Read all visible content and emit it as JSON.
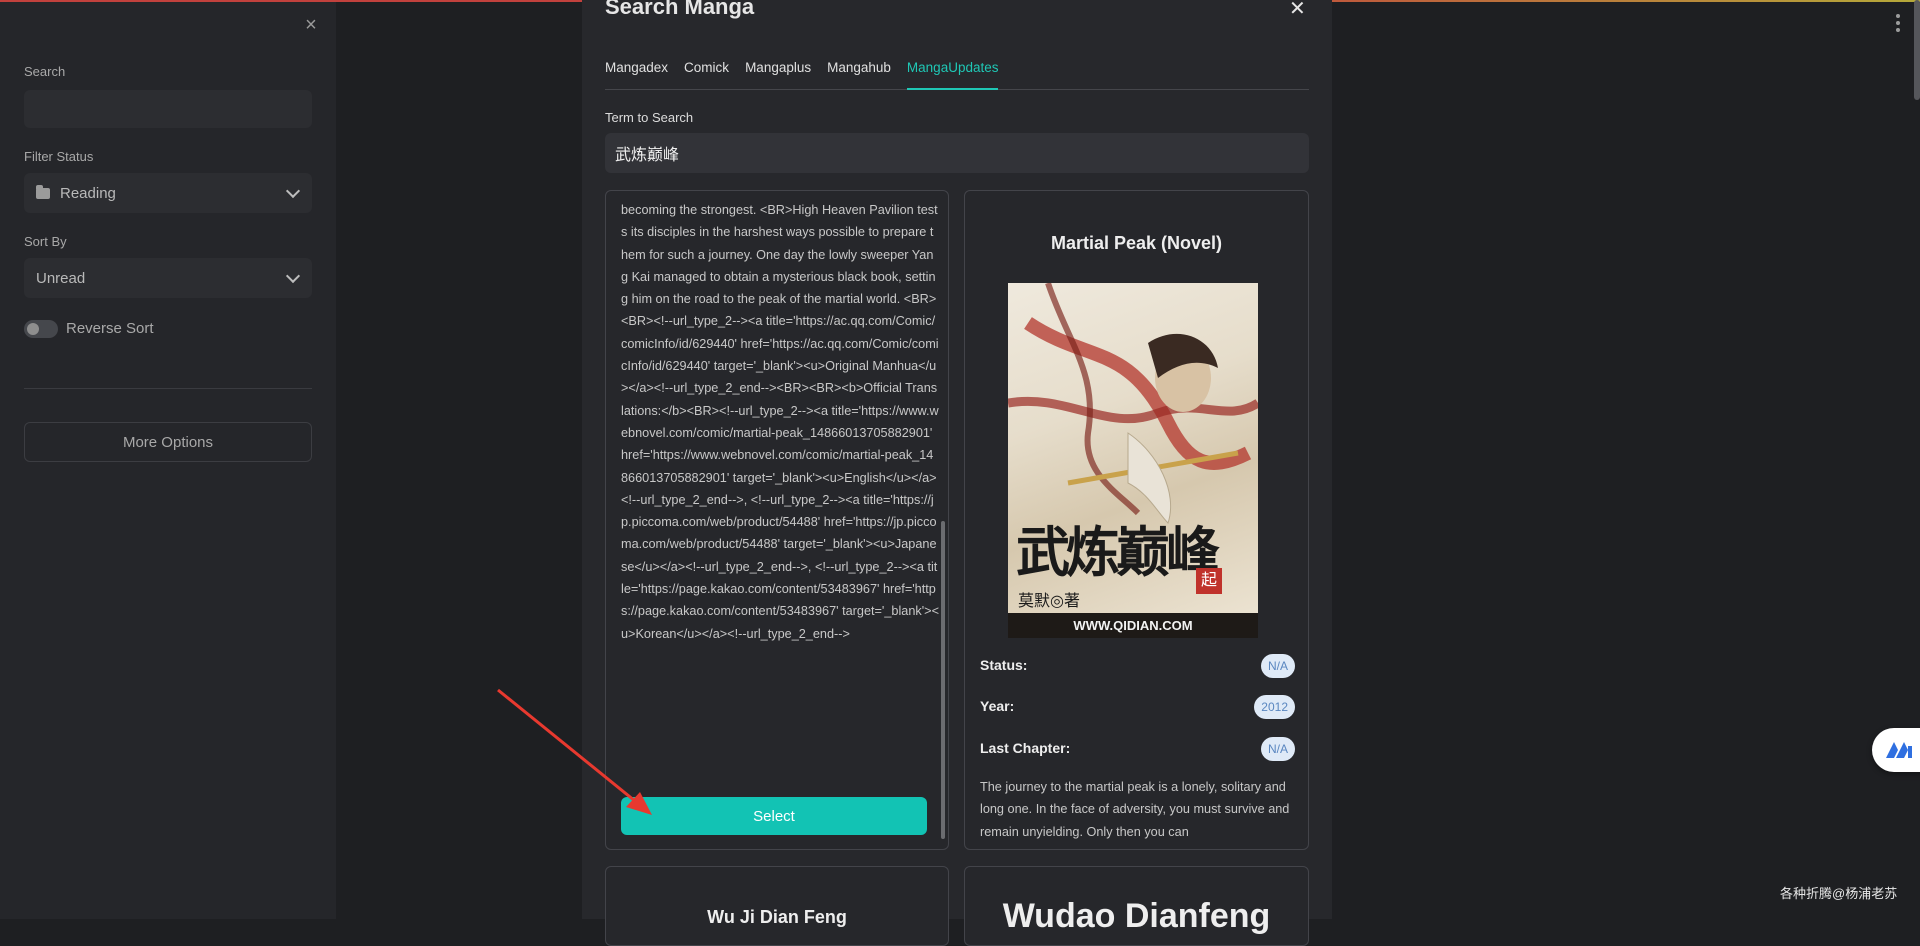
{
  "sidebar": {
    "search_label": "Search",
    "search_value": "",
    "filter_label": "Filter Status",
    "filter_value": "Reading",
    "sort_label": "Sort By",
    "sort_value": "Unread",
    "reverse_label": "Reverse Sort",
    "reverse_on": false,
    "more_button": "More Options"
  },
  "modal": {
    "title": "Search Manga",
    "tabs": [
      {
        "label": "Mangadex",
        "active": false
      },
      {
        "label": "Comick",
        "active": false
      },
      {
        "label": "Mangaplus",
        "active": false
      },
      {
        "label": "Mangahub",
        "active": false
      },
      {
        "label": "MangaUpdates",
        "active": true
      }
    ],
    "term_label": "Term to Search",
    "term_value": "武炼巅峰",
    "result_left": {
      "description": "becoming the strongest. <BR>High Heaven Pavilion tests its disciples in the harshest ways possible to prepare them for such a journey. One day the lowly sweeper Yang Kai managed to obtain a mysterious black book, setting him on the road to the peak of the martial world. <BR><BR><!--url_type_2--><a title='https://ac.qq.com/Comic/comicInfo/id/629440' href='https://ac.qq.com/Comic/comicInfo/id/629440' target='_blank'><u>Original Manhua</u></a><!--url_type_2_end--><BR><BR><b>Official Translations:</b><BR><!--url_type_2--><a title='https://www.webnovel.com/comic/martial-peak_14866013705882901' href='https://www.webnovel.com/comic/martial-peak_14866013705882901' target='_blank'><u>English</u></a><!--url_type_2_end-->, <!--url_type_2--><a title='https://jp.piccoma.com/web/product/54488' href='https://jp.piccoma.com/web/product/54488' target='_blank'><u>Japanese</u></a><!--url_type_2_end-->, <!--url_type_2--><a title='https://page.kakao.com/content/53483967' href='https://page.kakao.com/content/53483967' target='_blank'><u>Korean</u></a><!--url_type_2_end-->",
      "select_label": "Select"
    },
    "result_right": {
      "title": "Martial Peak (Novel)",
      "cover_chars": "武炼巅峰",
      "cover_author": "莫默◎著",
      "cover_site": "WWW.QIDIAN.COM",
      "cover_seal": "起",
      "status_label": "Status:",
      "status_value": "N/A",
      "year_label": "Year:",
      "year_value": "2012",
      "chapter_label": "Last Chapter:",
      "chapter_value": "N/A",
      "synopsis": "The journey to the martial peak is a lonely, solitary and long one. In the face of adversity, you must survive and remain unyielding. Only then you can"
    },
    "result_bottom_left_title": "Wu Ji Dian Feng",
    "result_bottom_right_title": "Wudao Dianfeng"
  },
  "watermark": "各种折腾@杨浦老苏",
  "colors": {
    "accent": "#12c3b4",
    "badge_bg": "#dfeaf7",
    "badge_text": "#5a87c0"
  }
}
